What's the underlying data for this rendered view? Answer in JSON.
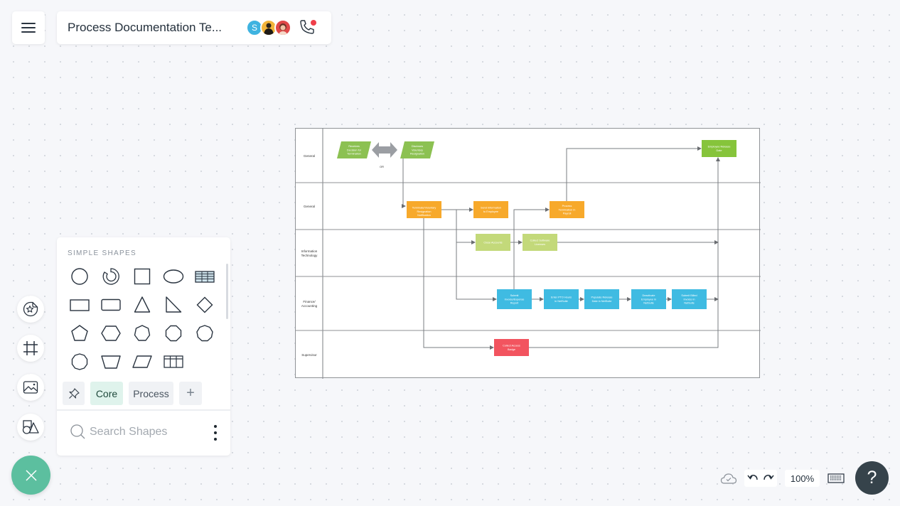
{
  "header": {
    "menu_icon": "hamburger-menu-icon",
    "document_title": "Process Documentation Te...",
    "collaborators": [
      {
        "initial": "S",
        "color": "#3fb3e0"
      },
      {
        "initial": "",
        "color": "#f2b43a"
      },
      {
        "initial": "",
        "color": "#e04848"
      }
    ],
    "call_icon": "phone-icon",
    "call_indicator_color": "#ef3f4a"
  },
  "left_toolbar": {
    "tools": [
      {
        "name": "sticker-icon"
      },
      {
        "name": "frame-icon"
      },
      {
        "name": "image-icon"
      },
      {
        "name": "shapes-icon"
      }
    ],
    "fab_icon": "close-icon",
    "fab_color": "#5cbf9f"
  },
  "shape_panel": {
    "heading": "SIMPLE SHAPES",
    "shapes": [
      "circle",
      "arc",
      "square",
      "ellipse",
      "table",
      "rectangle",
      "rounded-rectangle",
      "triangle",
      "right-triangle",
      "diamond",
      "pentagon",
      "hexagon",
      "heptagon",
      "octagon",
      "nonagon",
      "decagon",
      "trapezoid",
      "parallelogram",
      "grid"
    ],
    "tabs": {
      "pin_icon": "pin-icon",
      "core": "Core",
      "process": "Process",
      "add": "+"
    },
    "search_placeholder": "Search Shapes",
    "more_icon": "more-options-icon"
  },
  "diagram": {
    "lanes": [
      "General",
      "General",
      "Information Technology",
      "Finance/ Accounting",
      "Supervisor"
    ],
    "or_label": "OR",
    "nodes": [
      {
        "id": "n1",
        "label": "Receives Decision for Termination",
        "color": "#8cc152",
        "shape": "parallelogram"
      },
      {
        "id": "n2",
        "label": "Discloses Voluntary Resignation",
        "color": "#8cc152",
        "shape": "parallelogram"
      },
      {
        "id": "n3",
        "label": "Terminate/Voluntary Resignation Notification",
        "color": "#f7a92b",
        "shape": "rect"
      },
      {
        "id": "n4",
        "label": "Send Information to Employee",
        "color": "#f7a92b",
        "shape": "rect"
      },
      {
        "id": "n5",
        "label": "Process Termination in Payroll",
        "color": "#f7a92b",
        "shape": "rect"
      },
      {
        "id": "n6",
        "label": "Employee Release Date",
        "color": "#86c43b",
        "shape": "rect"
      },
      {
        "id": "n7",
        "label": "Close Accounts",
        "color": "#c3d97a",
        "shape": "rect"
      },
      {
        "id": "n8",
        "label": "Collect Software Licenses",
        "color": "#c3d97a",
        "shape": "rect"
      },
      {
        "id": "n9",
        "label": "Submit Invoice/Expense Report",
        "color": "#3fbbe2",
        "shape": "rect"
      },
      {
        "id": "n10",
        "label": "Enter PTO Hours in NetSuite",
        "color": "#3fbbe2",
        "shape": "rect"
      },
      {
        "id": "n11",
        "label": "Populate Release Date in NetSuite",
        "color": "#3fbbe2",
        "shape": "rect"
      },
      {
        "id": "n12",
        "label": "Deactivate Employee in NetSuite",
        "color": "#3fbbe2",
        "shape": "rect"
      },
      {
        "id": "n13",
        "label": "Submit Billed Invoice in NetSuite",
        "color": "#3fbbe2",
        "shape": "rect"
      },
      {
        "id": "n14",
        "label": "Collect Access Badge",
        "color": "#f2545f",
        "shape": "rect"
      }
    ]
  },
  "bottom_bar": {
    "sync_icon": "cloud-saved-icon",
    "undo_icon": "undo-icon",
    "redo_icon": "redo-icon",
    "zoom_level": "100%",
    "keyboard_icon": "keyboard-shortcuts-icon",
    "help_label": "?"
  }
}
